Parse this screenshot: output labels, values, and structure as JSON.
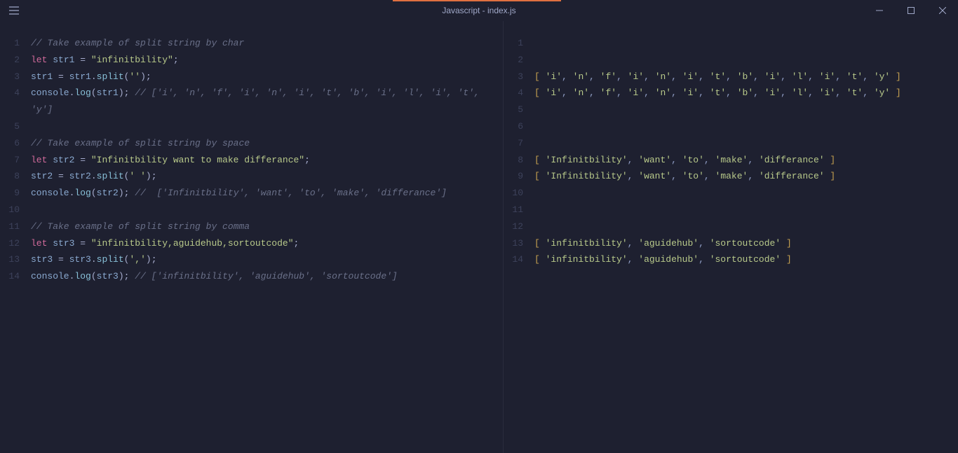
{
  "title": "Javascript - index.js",
  "leftLines": [
    {
      "n": "1",
      "tokens": [
        {
          "c": "c-com",
          "t": "// Take example of split string by char"
        }
      ]
    },
    {
      "n": "2",
      "tokens": [
        {
          "c": "c-kw",
          "t": "let"
        },
        {
          "c": "c-pun",
          "t": " "
        },
        {
          "c": "c-var",
          "t": "str1"
        },
        {
          "c": "c-pun",
          "t": " = "
        },
        {
          "c": "c-str",
          "t": "\"infinitbility\""
        },
        {
          "c": "c-pun",
          "t": ";"
        }
      ]
    },
    {
      "n": "3",
      "tokens": [
        {
          "c": "c-var",
          "t": "str1"
        },
        {
          "c": "c-pun",
          "t": " = "
        },
        {
          "c": "c-var",
          "t": "str1"
        },
        {
          "c": "c-pun",
          "t": "."
        },
        {
          "c": "c-fn",
          "t": "split"
        },
        {
          "c": "c-pun",
          "t": "("
        },
        {
          "c": "c-str",
          "t": "''"
        },
        {
          "c": "c-pun",
          "t": ");"
        }
      ]
    },
    {
      "n": "4",
      "tokens": [
        {
          "c": "c-obj",
          "t": "console"
        },
        {
          "c": "c-pun",
          "t": "."
        },
        {
          "c": "c-fn",
          "t": "log"
        },
        {
          "c": "c-pun",
          "t": "("
        },
        {
          "c": "c-var",
          "t": "str1"
        },
        {
          "c": "c-pun",
          "t": "); "
        },
        {
          "c": "c-com",
          "t": "// ['i', 'n', 'f', 'i', 'n', 'i', 't', 'b', 'i', 'l', 'i', 't', 'y']"
        }
      ]
    },
    {
      "n": "5",
      "tokens": []
    },
    {
      "n": "6",
      "tokens": [
        {
          "c": "c-com",
          "t": "// Take example of split string by space"
        }
      ]
    },
    {
      "n": "7",
      "tokens": [
        {
          "c": "c-kw",
          "t": "let"
        },
        {
          "c": "c-pun",
          "t": " "
        },
        {
          "c": "c-var",
          "t": "str2"
        },
        {
          "c": "c-pun",
          "t": " = "
        },
        {
          "c": "c-str",
          "t": "\"Infinitbility want to make differance\""
        },
        {
          "c": "c-pun",
          "t": ";"
        }
      ]
    },
    {
      "n": "8",
      "tokens": [
        {
          "c": "c-var",
          "t": "str2"
        },
        {
          "c": "c-pun",
          "t": " = "
        },
        {
          "c": "c-var",
          "t": "str2"
        },
        {
          "c": "c-pun",
          "t": "."
        },
        {
          "c": "c-fn",
          "t": "split"
        },
        {
          "c": "c-pun",
          "t": "("
        },
        {
          "c": "c-str",
          "t": "' '"
        },
        {
          "c": "c-pun",
          "t": ");"
        }
      ]
    },
    {
      "n": "9",
      "tokens": [
        {
          "c": "c-obj",
          "t": "console"
        },
        {
          "c": "c-pun",
          "t": "."
        },
        {
          "c": "c-fn",
          "t": "log"
        },
        {
          "c": "c-pun",
          "t": "("
        },
        {
          "c": "c-var",
          "t": "str2"
        },
        {
          "c": "c-pun",
          "t": "); "
        },
        {
          "c": "c-com",
          "t": "//  ['Infinitbility', 'want', 'to', 'make', 'differance']"
        }
      ]
    },
    {
      "n": "10",
      "tokens": []
    },
    {
      "n": "11",
      "tokens": [
        {
          "c": "c-com",
          "t": "// Take example of split string by comma"
        }
      ]
    },
    {
      "n": "12",
      "tokens": [
        {
          "c": "c-kw",
          "t": "let"
        },
        {
          "c": "c-pun",
          "t": " "
        },
        {
          "c": "c-var",
          "t": "str3"
        },
        {
          "c": "c-pun",
          "t": " = "
        },
        {
          "c": "c-str",
          "t": "\"infinitbility,aguidehub,sortoutcode\""
        },
        {
          "c": "c-pun",
          "t": ";"
        }
      ]
    },
    {
      "n": "13",
      "tokens": [
        {
          "c": "c-var",
          "t": "str3"
        },
        {
          "c": "c-pun",
          "t": " = "
        },
        {
          "c": "c-var",
          "t": "str3"
        },
        {
          "c": "c-pun",
          "t": "."
        },
        {
          "c": "c-fn",
          "t": "split"
        },
        {
          "c": "c-pun",
          "t": "("
        },
        {
          "c": "c-str",
          "t": "','"
        },
        {
          "c": "c-pun",
          "t": ");"
        }
      ]
    },
    {
      "n": "14",
      "tokens": [
        {
          "c": "c-obj",
          "t": "console"
        },
        {
          "c": "c-pun",
          "t": "."
        },
        {
          "c": "c-fn",
          "t": "log"
        },
        {
          "c": "c-pun",
          "t": "("
        },
        {
          "c": "c-var",
          "t": "str3"
        },
        {
          "c": "c-pun",
          "t": "); "
        },
        {
          "c": "c-com",
          "t": "// ['infinitbility', 'aguidehub', 'sortoutcode']"
        }
      ]
    }
  ],
  "rightLines": [
    {
      "n": "1",
      "arr": null
    },
    {
      "n": "2",
      "arr": null
    },
    {
      "n": "3",
      "arr": [
        "i",
        "n",
        "f",
        "i",
        "n",
        "i",
        "t",
        "b",
        "i",
        "l",
        "i",
        "t",
        "y"
      ]
    },
    {
      "n": "4",
      "arr": [
        "i",
        "n",
        "f",
        "i",
        "n",
        "i",
        "t",
        "b",
        "i",
        "l",
        "i",
        "t",
        "y"
      ]
    },
    {
      "n": "5",
      "arr": null
    },
    {
      "n": "6",
      "arr": null
    },
    {
      "n": "7",
      "arr": null
    },
    {
      "n": "8",
      "arr": [
        "Infinitbility",
        "want",
        "to",
        "make",
        "differance"
      ]
    },
    {
      "n": "9",
      "arr": [
        "Infinitbility",
        "want",
        "to",
        "make",
        "differance"
      ]
    },
    {
      "n": "10",
      "arr": null
    },
    {
      "n": "11",
      "arr": null
    },
    {
      "n": "12",
      "arr": null
    },
    {
      "n": "13",
      "arr": [
        "infinitbility",
        "aguidehub",
        "sortoutcode"
      ]
    },
    {
      "n": "14",
      "arr": [
        "infinitbility",
        "aguidehub",
        "sortoutcode"
      ]
    }
  ]
}
